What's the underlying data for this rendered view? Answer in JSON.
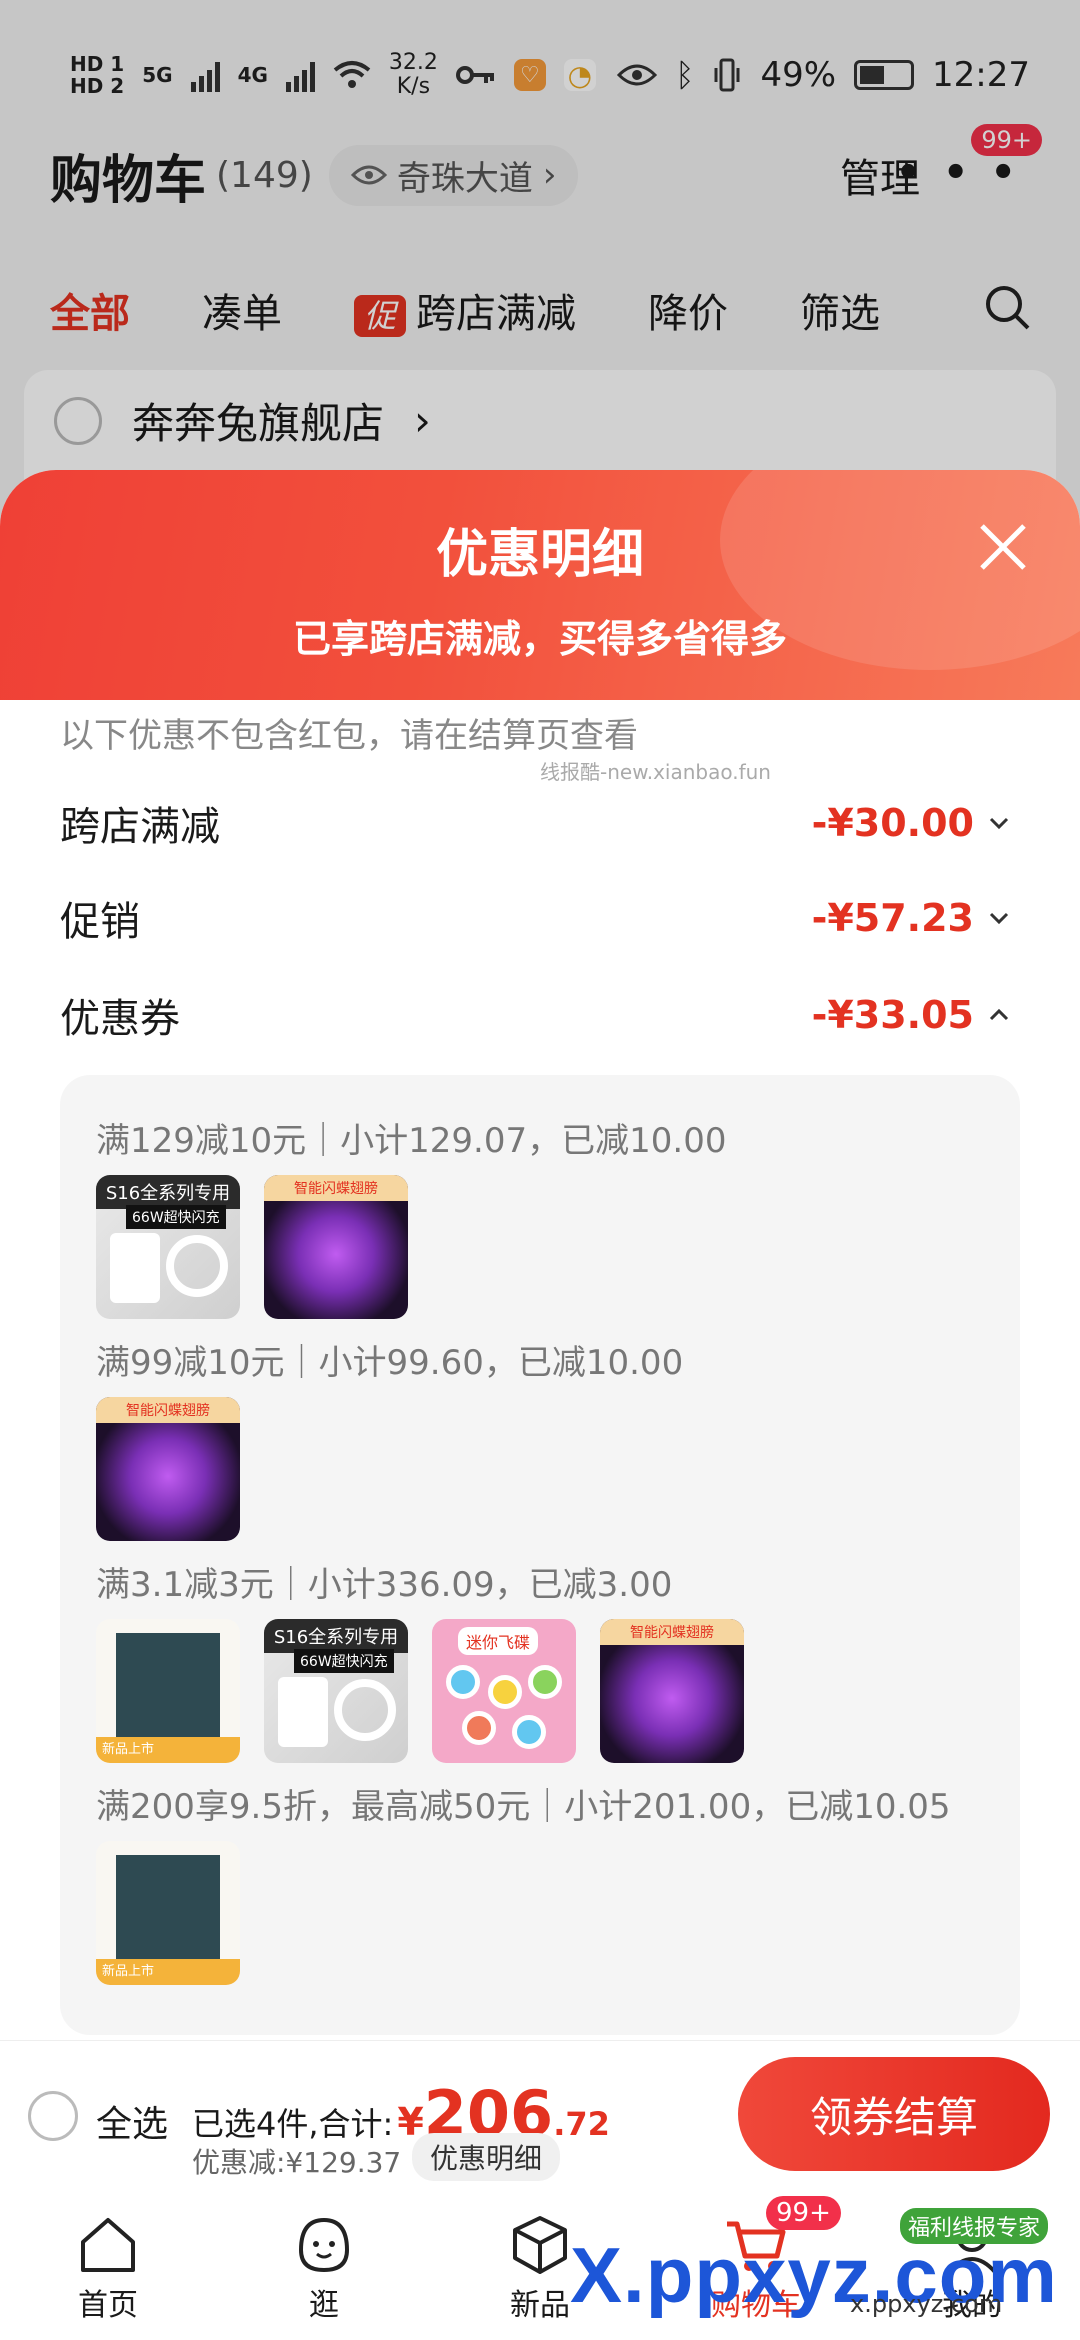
{
  "status_bar": {
    "hd1": "HD 1",
    "hd2": "HD 2",
    "net1": "5G",
    "net2": "4G",
    "speed_value": "32.2",
    "speed_unit": "K/s",
    "battery": "49%",
    "time": "12:27"
  },
  "header": {
    "title": "购物车",
    "count": "(149)",
    "location": "奇珠大道",
    "manage": "管理",
    "badge": "99+"
  },
  "tabs": [
    {
      "label": "全部"
    },
    {
      "label": "凑单"
    },
    {
      "label": "跨店满减",
      "tag": "促"
    },
    {
      "label": "降价"
    },
    {
      "label": "筛选"
    }
  ],
  "store": {
    "name": "奔奔兔旗舰店"
  },
  "sheet": {
    "title": "优惠明细",
    "subtitle": "已享跨店满减，买得多省得多",
    "note": "以下优惠不包含红包，请在结算页查看",
    "watermark": "线报酷-new.xianbao.fun",
    "rows": [
      {
        "label": "跨店满减",
        "amount": "-¥30.00"
      },
      {
        "label": "促销",
        "amount": "-¥57.23"
      },
      {
        "label": "优惠券",
        "amount": "-¥33.05"
      }
    ],
    "coupon_groups": [
      {
        "label": "满129减10元｜小计129.07，已减10.00"
      },
      {
        "label": "满99减10元｜小计99.60，已减10.00"
      },
      {
        "label": "满3.1减3元｜小计336.09，已减3.00"
      },
      {
        "label": "满200享9.5折，最高减50元｜小计201.00，已减10.05"
      }
    ],
    "thumb_text": {
      "charger_cap": "S16全系列专用",
      "charger_cap2": "66W超快闪充",
      "wings_cap": "智能闪蝶翅膀",
      "toy_cap": "迷你飞碟",
      "book_band": "新品上市"
    }
  },
  "bottom": {
    "select_all": "全选",
    "selected": "已选4件,合计:",
    "yen": "¥",
    "total_int": "206",
    "total_dec": ".72",
    "discount": "优惠减:¥129.37",
    "detail": "优惠明细",
    "checkout": "领券结算"
  },
  "nav": [
    {
      "label": "首页"
    },
    {
      "label": "逛"
    },
    {
      "label": "新品"
    },
    {
      "label": "购物车",
      "badge": "99+"
    },
    {
      "label": "我的"
    }
  ],
  "overlay": {
    "brand": "X.ppxyz.com",
    "url": "x.ppxyz.com",
    "logo": "福利线报专家"
  }
}
